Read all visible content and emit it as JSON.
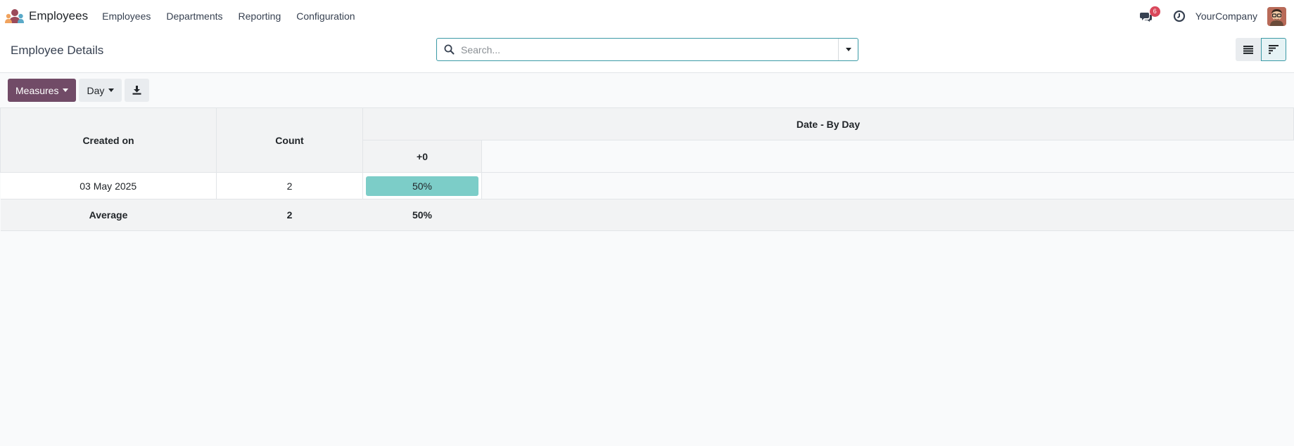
{
  "navbar": {
    "app_name": "Employees",
    "menu": [
      {
        "label": "Employees"
      },
      {
        "label": "Departments"
      },
      {
        "label": "Reporting"
      },
      {
        "label": "Configuration"
      }
    ],
    "chat_badge": "6",
    "company": "YourCompany"
  },
  "control_panel": {
    "title": "Employee Details",
    "search_placeholder": "Search..."
  },
  "toolbar": {
    "measures_label": "Measures",
    "interval_label": "Day"
  },
  "cohort": {
    "header_row_label": "Created on",
    "header_measure_label": "Count",
    "header_date_group": "Date - By Day",
    "interval_columns": [
      "+0"
    ],
    "rows": [
      {
        "date": "03 May 2025",
        "count": "2",
        "values": [
          "50%"
        ],
        "fill_fraction": [
          0.5
        ]
      }
    ],
    "footer": {
      "label": "Average",
      "count": "2",
      "values": [
        "50%"
      ]
    }
  },
  "colors": {
    "brand": "#714b67",
    "accent": "#3b9aa6",
    "cohort_fill": "#7ccdc8",
    "badge": "#d9475b"
  },
  "icons": {
    "download": "download-icon",
    "list_view": "list-view-icon",
    "cohort_view": "cohort-view-icon"
  }
}
